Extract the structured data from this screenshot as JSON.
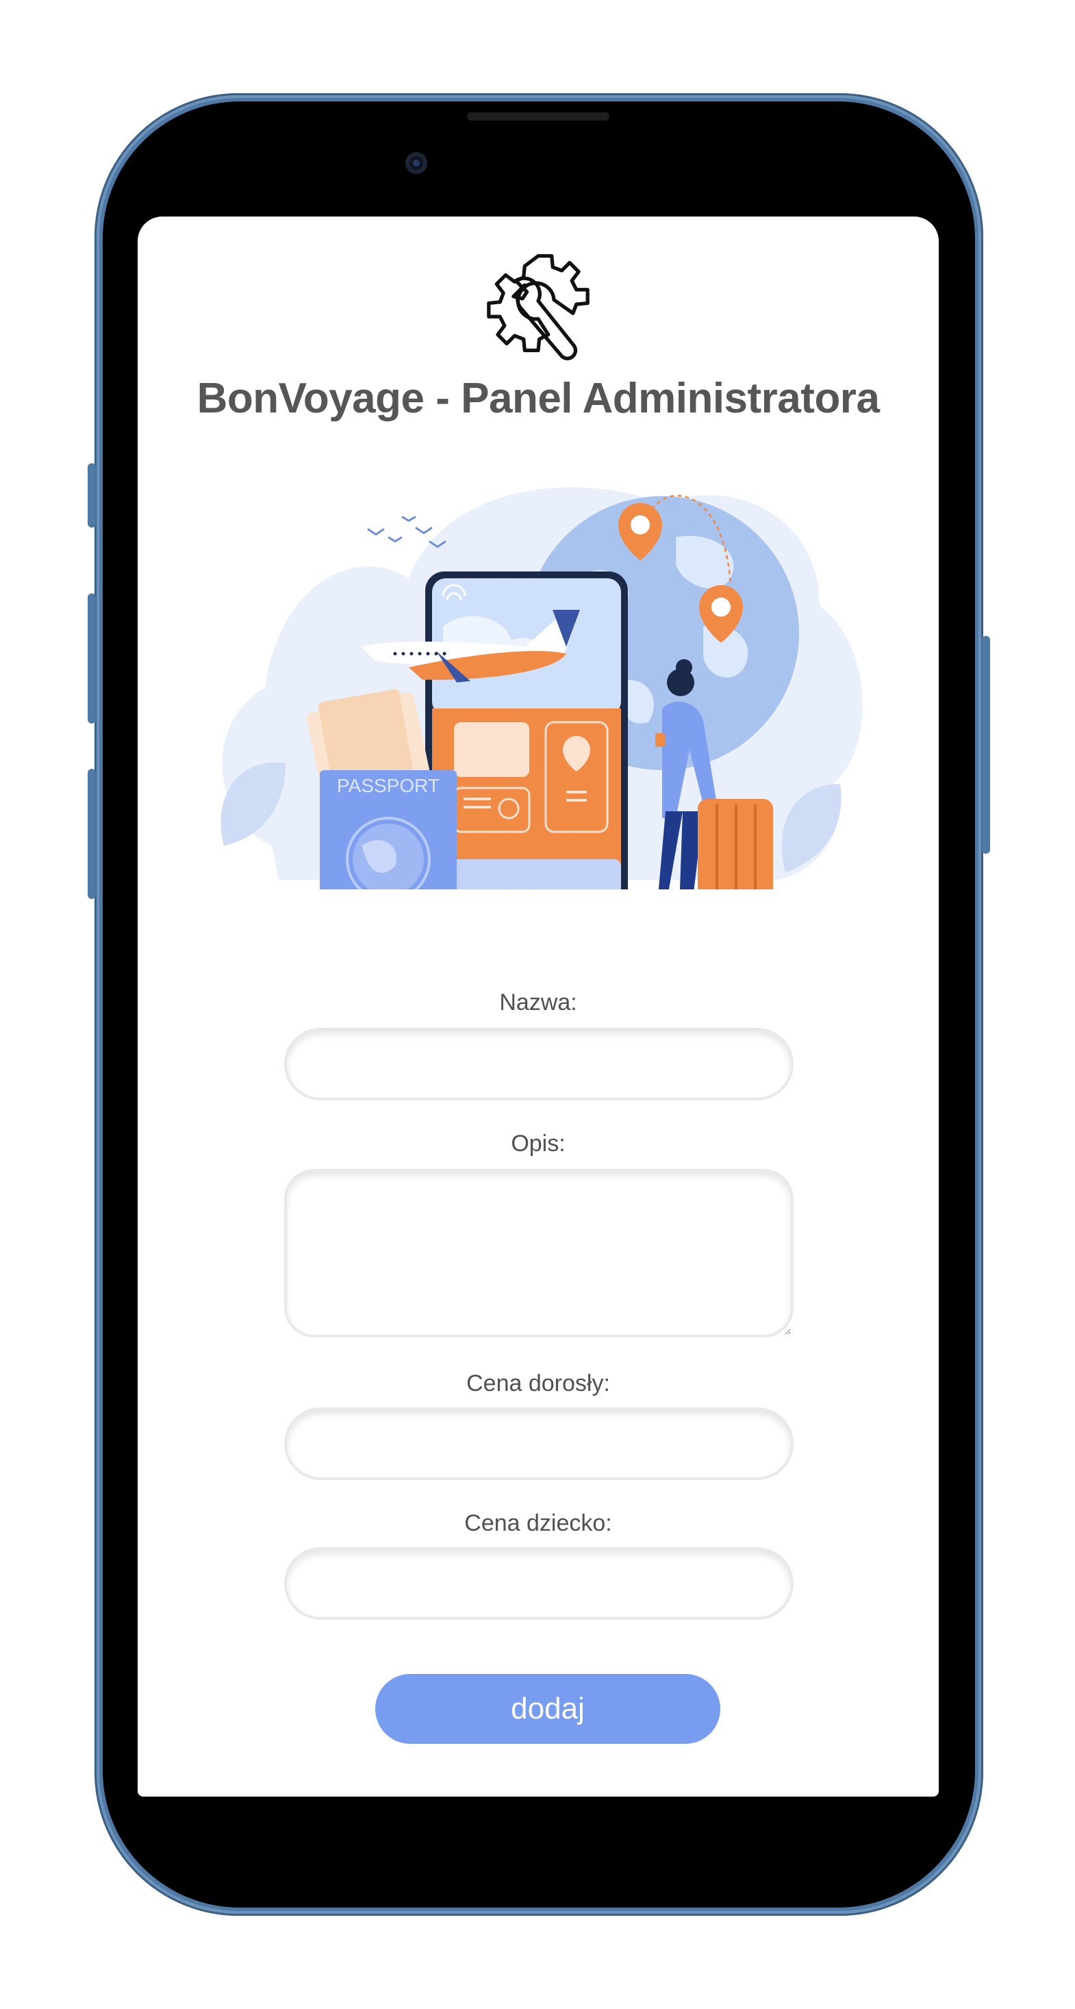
{
  "app": {
    "title": "BonVoyage - Panel Administratora"
  },
  "hero": {
    "passport_text": "PASSPORT"
  },
  "form": {
    "name_label": "Nazwa:",
    "description_label": "Opis:",
    "adult_price_label": "Cena dorosły:",
    "child_price_label": "Cena dziecko:",
    "name_value": "",
    "description_value": "",
    "adult_price_value": "",
    "child_price_value": "",
    "submit_label": "dodaj"
  },
  "colors": {
    "accent": "#789cef",
    "title": "#565656",
    "phone_frame": "#4f7aa6",
    "illustration_orange": "#f18a45",
    "illustration_blue": "#7e9ff0"
  },
  "icons": {
    "header": "gear-wrench-icon"
  }
}
